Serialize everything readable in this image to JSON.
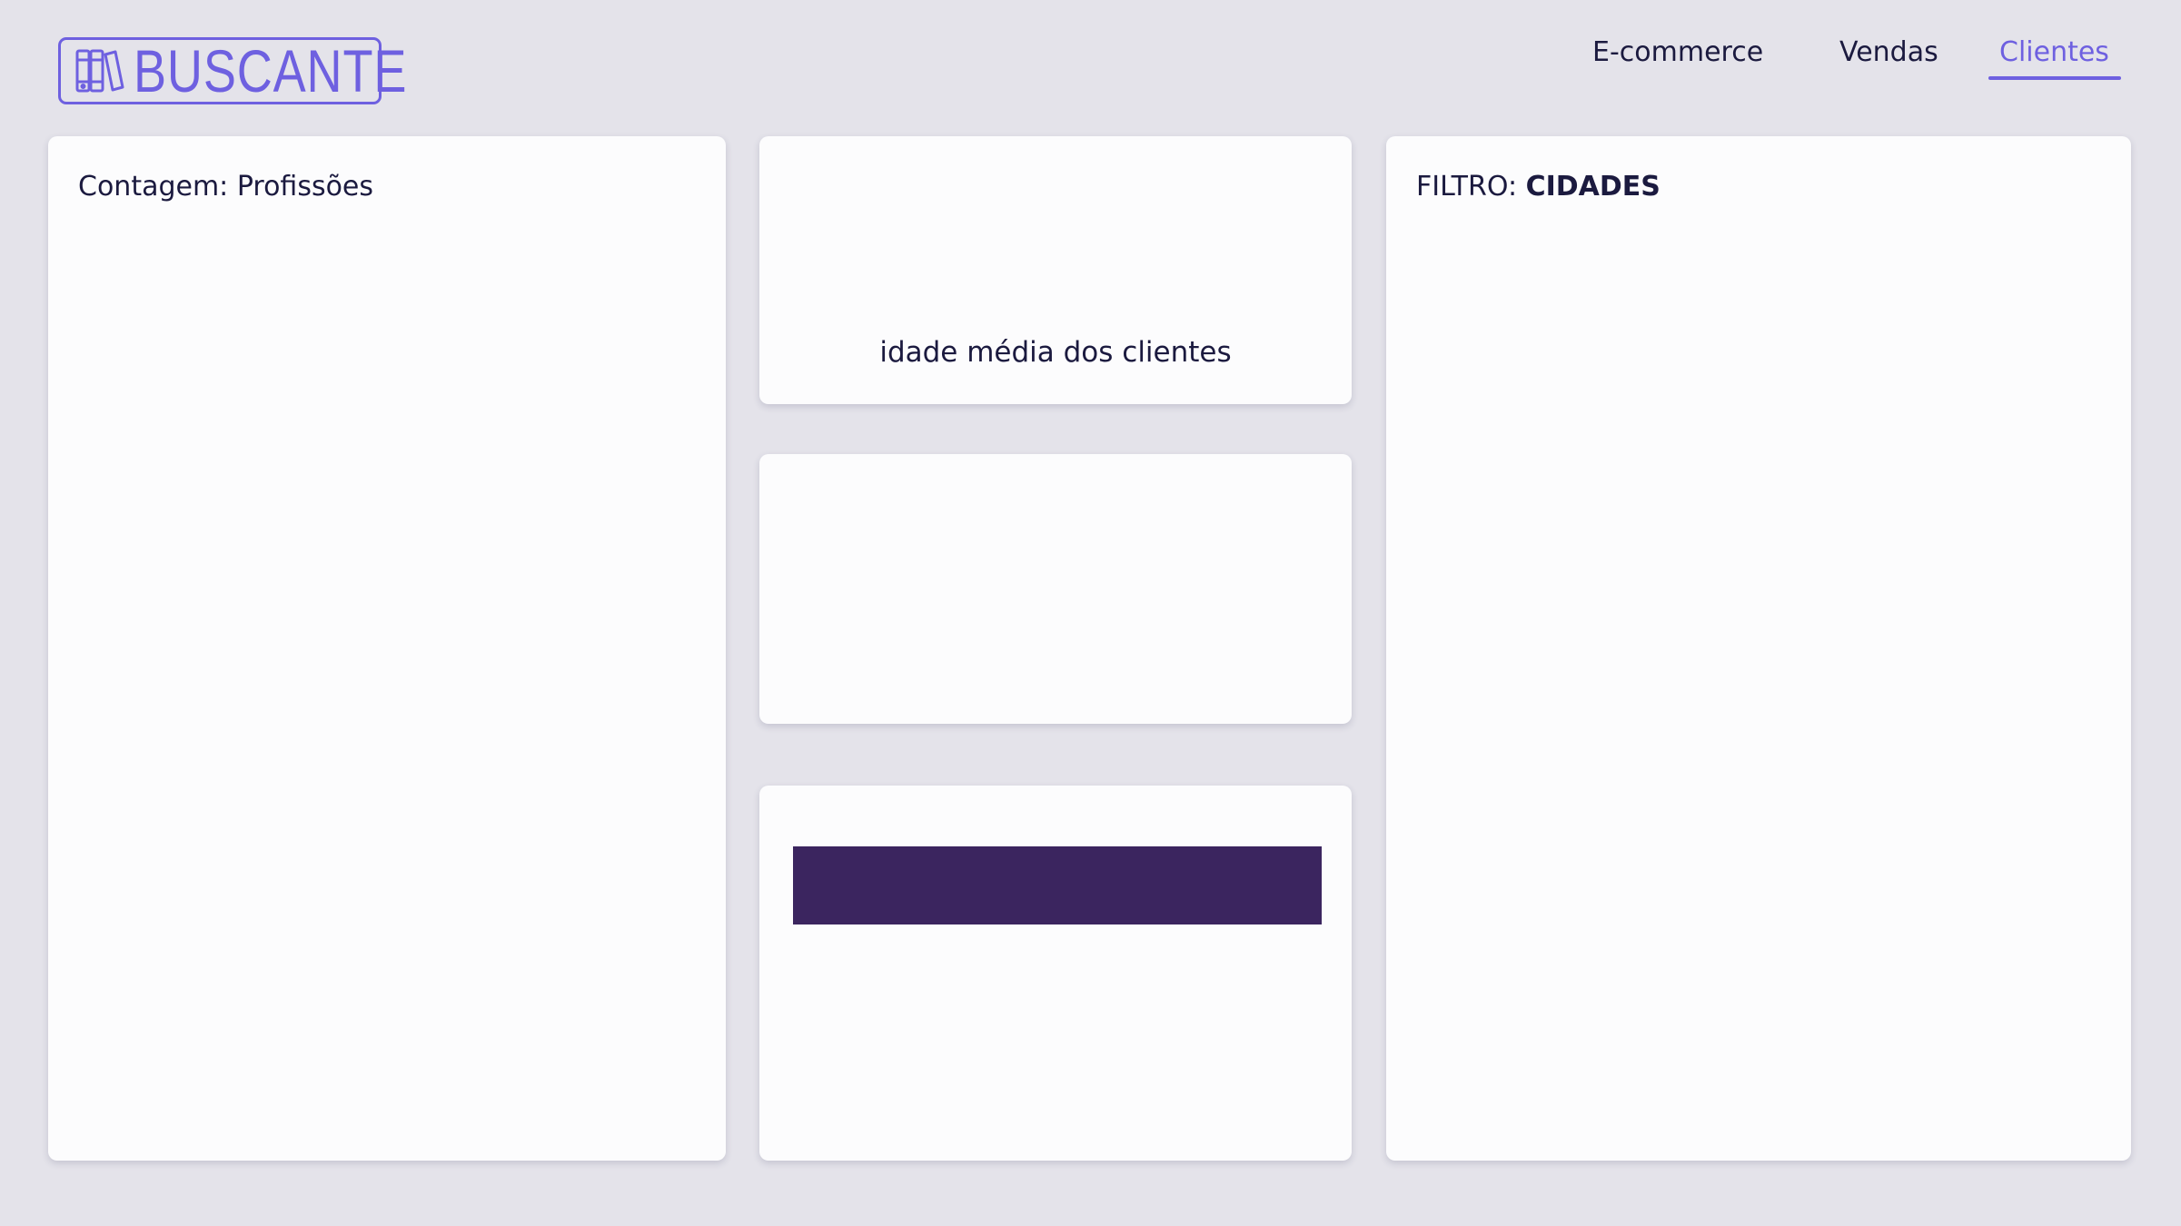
{
  "brand": {
    "name": "BUSCANTE",
    "icon": "books-icon",
    "color": "#6e60e0"
  },
  "nav": {
    "items": [
      {
        "label": "E-commerce",
        "active": false
      },
      {
        "label": "Vendas",
        "active": false
      },
      {
        "label": "Clientes",
        "active": true
      }
    ],
    "active_color": "#6e60e0"
  },
  "cards": {
    "professions": {
      "title": "Contagem: Profissões"
    },
    "avg_age": {
      "caption": "idade média dos clientes"
    },
    "cities_filter": {
      "prefix": "FILTRO: ",
      "label": "CIDADES"
    },
    "bar_color": "#3b255f"
  },
  "colors": {
    "background": "#e4e3ea",
    "card": "#fcfcfd",
    "text": "#1b1a3f"
  }
}
